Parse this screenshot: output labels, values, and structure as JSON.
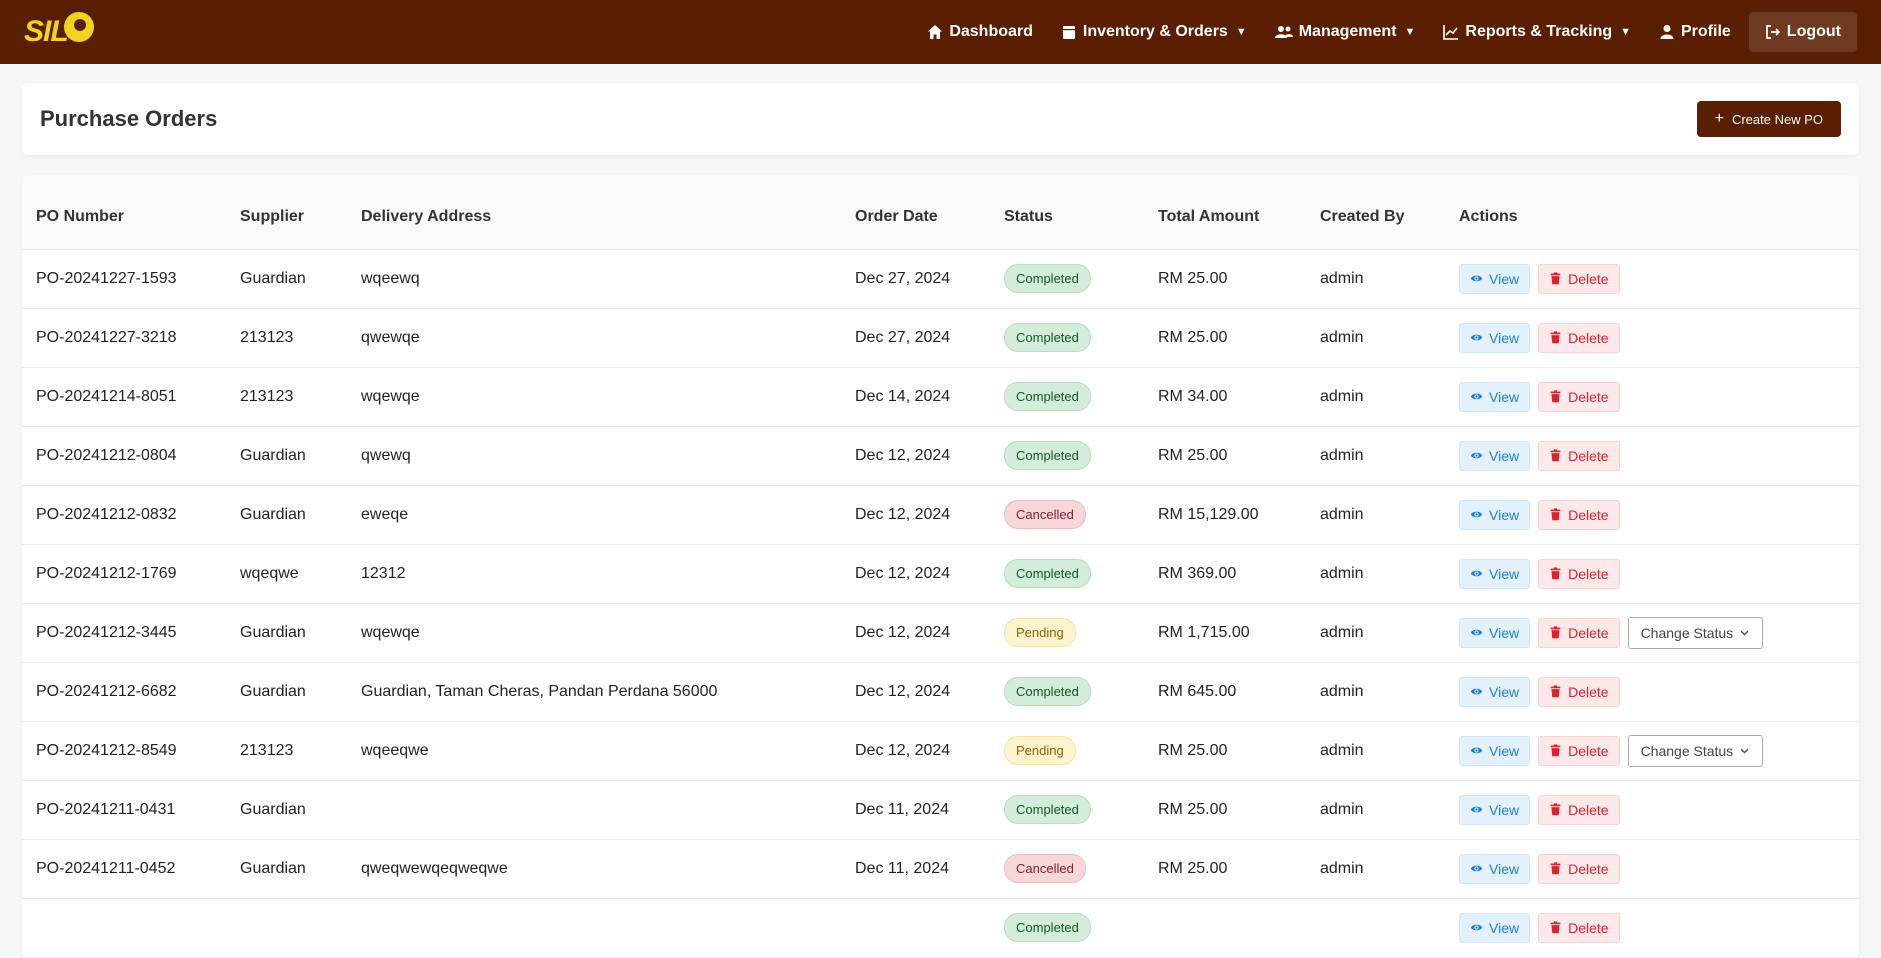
{
  "brand": {
    "logo_text": "SIL"
  },
  "nav": {
    "dashboard": "Dashboard",
    "inventory": "Inventory & Orders",
    "management": "Management",
    "reports": "Reports & Tracking",
    "profile": "Profile",
    "logout": "Logout"
  },
  "header": {
    "title": "Purchase Orders",
    "create_label": "Create New PO"
  },
  "table": {
    "columns": [
      "PO Number",
      "Supplier",
      "Delivery Address",
      "Order Date",
      "Status",
      "Total Amount",
      "Created By",
      "Actions"
    ],
    "view_label": "View",
    "delete_label": "Delete",
    "change_status_label": "Change Status",
    "rows": [
      {
        "po": "PO-20241227-1593",
        "supplier": "Guardian",
        "address": "wqeewq",
        "date": "Dec 27, 2024",
        "status": "Completed",
        "amount": "RM 25.00",
        "by": "admin"
      },
      {
        "po": "PO-20241227-3218",
        "supplier": "213123",
        "address": "qwewqe",
        "date": "Dec 27, 2024",
        "status": "Completed",
        "amount": "RM 25.00",
        "by": "admin"
      },
      {
        "po": "PO-20241214-8051",
        "supplier": "213123",
        "address": "wqewqe",
        "date": "Dec 14, 2024",
        "status": "Completed",
        "amount": "RM 34.00",
        "by": "admin"
      },
      {
        "po": "PO-20241212-0804",
        "supplier": "Guardian",
        "address": "qwewq",
        "date": "Dec 12, 2024",
        "status": "Completed",
        "amount": "RM 25.00",
        "by": "admin"
      },
      {
        "po": "PO-20241212-0832",
        "supplier": "Guardian",
        "address": "eweqe",
        "date": "Dec 12, 2024",
        "status": "Cancelled",
        "amount": "RM 15,129.00",
        "by": "admin"
      },
      {
        "po": "PO-20241212-1769",
        "supplier": "wqeqwe",
        "address": "12312",
        "date": "Dec 12, 2024",
        "status": "Completed",
        "amount": "RM 369.00",
        "by": "admin"
      },
      {
        "po": "PO-20241212-3445",
        "supplier": "Guardian",
        "address": "wqewqe",
        "date": "Dec 12, 2024",
        "status": "Pending",
        "amount": "RM 1,715.00",
        "by": "admin"
      },
      {
        "po": "PO-20241212-6682",
        "supplier": "Guardian",
        "address": "Guardian, Taman Cheras, Pandan Perdana 56000",
        "date": "Dec 12, 2024",
        "status": "Completed",
        "amount": "RM 645.00",
        "by": "admin"
      },
      {
        "po": "PO-20241212-8549",
        "supplier": "213123",
        "address": "wqeeqwe",
        "date": "Dec 12, 2024",
        "status": "Pending",
        "amount": "RM 25.00",
        "by": "admin"
      },
      {
        "po": "PO-20241211-0431",
        "supplier": "Guardian",
        "address": "",
        "date": "Dec 11, 2024",
        "status": "Completed",
        "amount": "RM 25.00",
        "by": "admin"
      },
      {
        "po": "PO-20241211-0452",
        "supplier": "Guardian",
        "address": "qweqwewqeqweqwe",
        "date": "Dec 11, 2024",
        "status": "Cancelled",
        "amount": "RM 25.00",
        "by": "admin"
      },
      {
        "po": "",
        "supplier": "",
        "address": "",
        "date": "",
        "status": "Completed",
        "amount": "",
        "by": ""
      }
    ]
  }
}
